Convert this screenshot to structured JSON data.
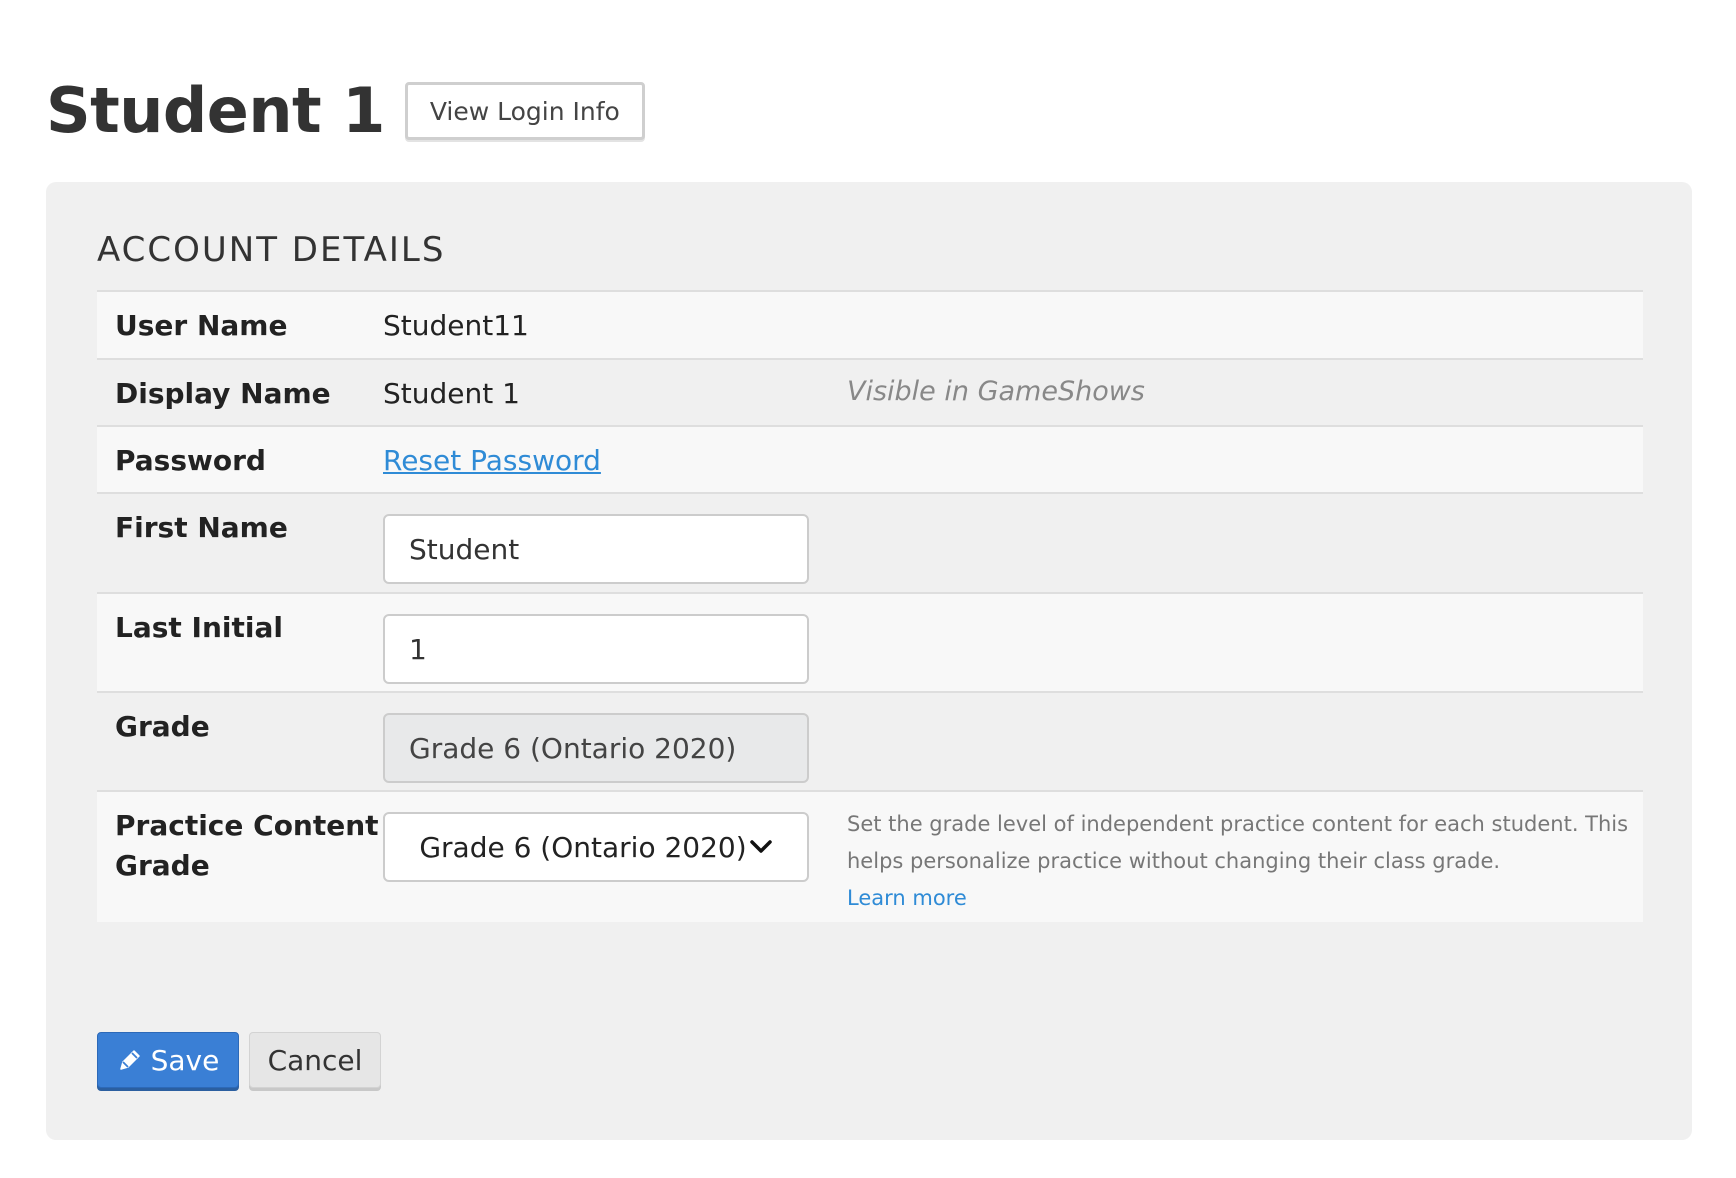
{
  "header": {
    "title": "Student 1",
    "view_login_label": "View Login Info"
  },
  "account": {
    "heading": "ACCOUNT DETAILS",
    "user_name": {
      "label": "User Name",
      "value": "Student11"
    },
    "display_name": {
      "label": "Display Name",
      "value": "Student 1",
      "hint": "Visible in GameShows"
    },
    "password": {
      "label": "Password",
      "link": "Reset Password"
    },
    "first_name": {
      "label": "First Name",
      "value": "Student"
    },
    "last_initial": {
      "label": "Last Initial",
      "value": "1"
    },
    "grade": {
      "label": "Grade",
      "value": "Grade 6 (Ontario 2020)"
    },
    "practice_grade": {
      "label_line1": "Practice Content",
      "label_line2": "Grade",
      "value": "Grade 6 (Ontario 2020)",
      "help": "Set the grade level of independent practice content for each student. This helps personalize practice without changing their class grade.",
      "learn_more": "Learn more"
    }
  },
  "actions": {
    "save_label": "Save",
    "cancel_label": "Cancel"
  },
  "icons": {
    "save": "pencil-icon",
    "select": "chevron-down-icon"
  },
  "colors": {
    "link": "#2f8bd6",
    "save_button": "#3a7fd5",
    "panel": "#f0f0f0"
  }
}
